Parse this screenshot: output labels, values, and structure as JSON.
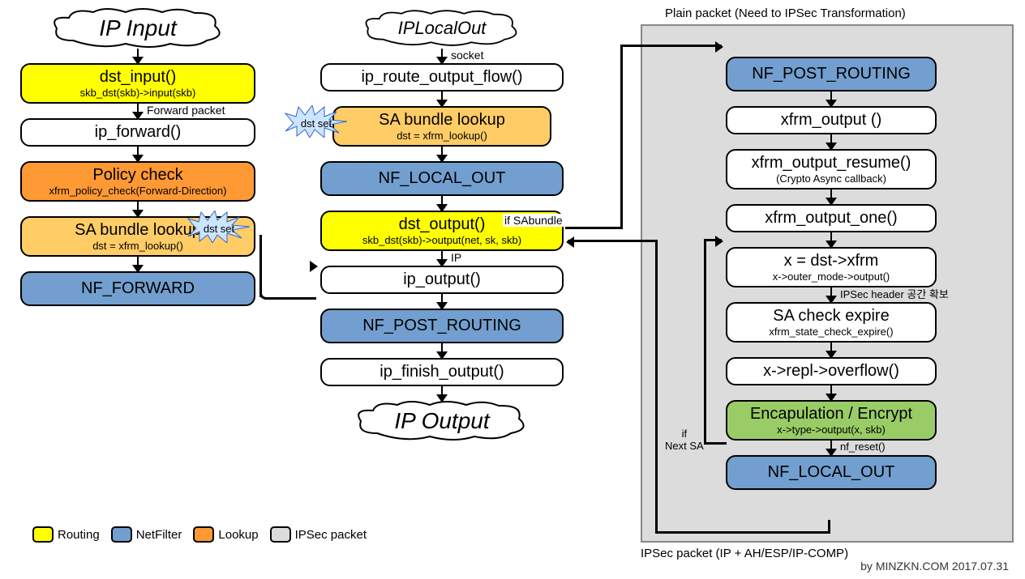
{
  "clouds": {
    "ip_input": "IP Input",
    "ip_local_out": "IPLocalOut",
    "ip_output": "IP Output"
  },
  "col1": {
    "dst_input": {
      "t": "dst_input()",
      "s": "skb_dst(skb)->input(skb)"
    },
    "ip_forward": {
      "t": "ip_forward()"
    },
    "policy_check": {
      "t": "Policy check",
      "s": "xfrm_policy_check(Forward-Direction)"
    },
    "sa_bundle": {
      "t": "SA bundle lookup",
      "s": "dst = xfrm_lookup()"
    },
    "nf_forward": {
      "t": "NF_FORWARD"
    }
  },
  "col2": {
    "ip_route": {
      "t": "ip_route_output_flow()"
    },
    "sa_bundle": {
      "t": "SA bundle lookup",
      "s": "dst = xfrm_lookup()"
    },
    "nf_local_out": {
      "t": "NF_LOCAL_OUT"
    },
    "dst_output": {
      "t": "dst_output()",
      "s": "skb_dst(skb)->output(net, sk, skb)"
    },
    "ip_output": {
      "t": "ip_output()"
    },
    "nf_post": {
      "t": "NF_POST_ROUTING"
    },
    "ip_finish": {
      "t": "ip_finish_output()"
    }
  },
  "col3": {
    "nf_post": {
      "t": "NF_POST_ROUTING"
    },
    "xfrm_out": {
      "t": "xfrm_output ()"
    },
    "xfrm_resume": {
      "t": "xfrm_output_resume()",
      "s": "(Crypto Async callback)"
    },
    "xfrm_one": {
      "t": "xfrm_output_one()"
    },
    "x_dst": {
      "t": "x = dst->xfrm",
      "s": "x->outer_mode->output()"
    },
    "sa_expire": {
      "t": "SA check expire",
      "s": "xfrm_state_check_expire()"
    },
    "x_repl": {
      "t": "x->repl->overflow()"
    },
    "encap": {
      "t": "Encapulation / Encrypt",
      "s": "x->type->output(x, skb)"
    },
    "nf_local_out": {
      "t": "NF_LOCAL_OUT"
    }
  },
  "labels": {
    "forward_packet": "Forward packet",
    "socket": "socket",
    "ip": "IP",
    "if_sabundle": "if SAbundle",
    "dst_set": "dst set",
    "ipsec_header": "IPSec header 공간 확보",
    "if_next_sa": "if\nNext SA",
    "nf_reset": "nf_reset()",
    "plain_packet": "Plain packet (Need to IPSec Transformation)",
    "ipsec_packet": "IPSec packet (IP + AH/ESP/IP-COMP)"
  },
  "legend": {
    "routing": "Routing",
    "netfilter": "NetFilter",
    "lookup": "Lookup",
    "ipsec": "IPSec packet"
  },
  "footer": "by MINZKN.COM 2017.07.31"
}
